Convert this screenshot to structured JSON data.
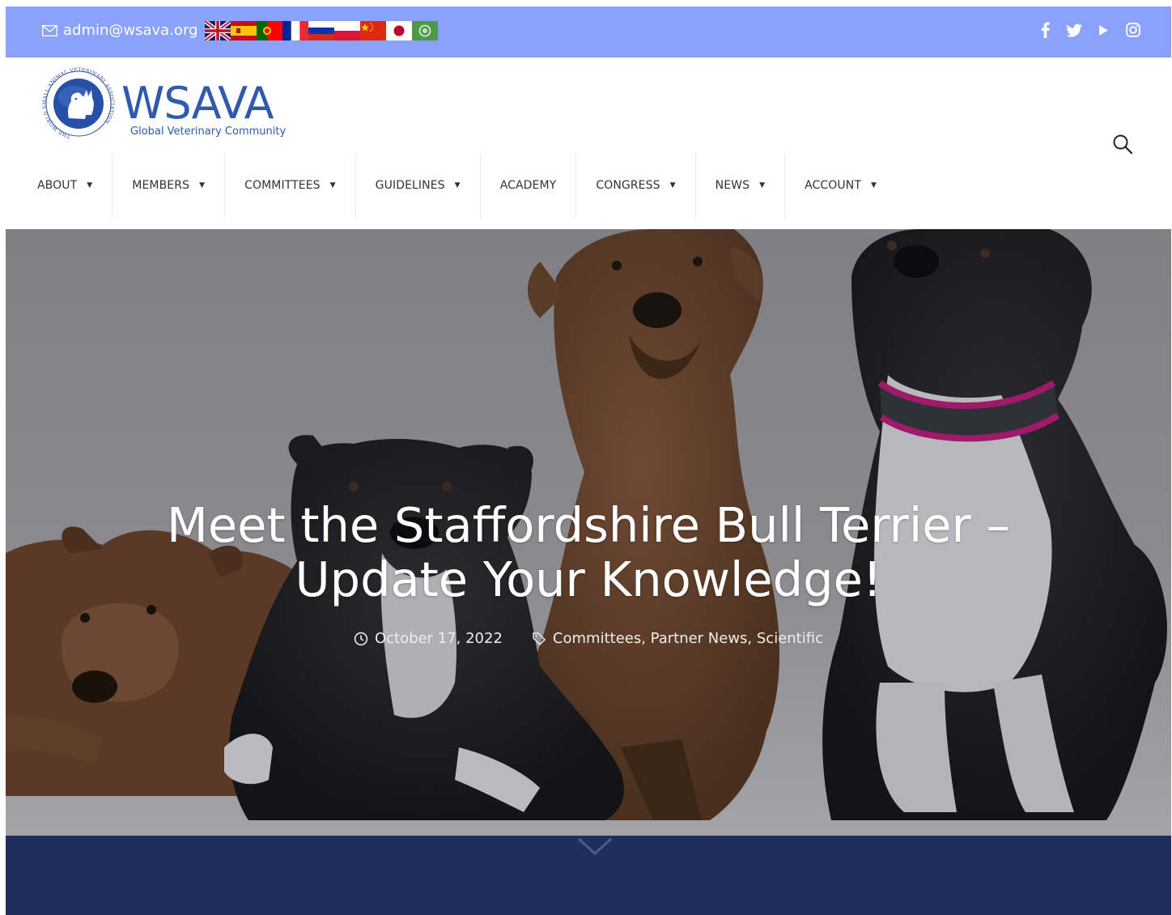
{
  "topbar": {
    "email": "admin@wsava.org",
    "flags": [
      "English",
      "Español",
      "Português",
      "Français",
      "Русский",
      "Polski",
      "中文",
      "日本語",
      "العربية"
    ],
    "socials": [
      "facebook-icon",
      "twitter-icon",
      "youtube-icon",
      "instagram-icon"
    ],
    "bg_color": "#8ba2fb"
  },
  "logo": {
    "wordmark": "WSAVA",
    "tagline": "Global Veterinary Community",
    "ring_text": "THE WORLD SMALL ANIMAL VETERINARY ASSOCIATION",
    "color": "#2a4fa6"
  },
  "nav": {
    "items": [
      {
        "label": "ABOUT",
        "dropdown": true
      },
      {
        "label": "MEMBERS",
        "dropdown": true
      },
      {
        "label": "COMMITTEES",
        "dropdown": true
      },
      {
        "label": "GUIDELINES",
        "dropdown": true
      },
      {
        "label": "ACADEMY",
        "dropdown": false
      },
      {
        "label": "CONGRESS",
        "dropdown": true
      },
      {
        "label": "NEWS",
        "dropdown": true
      },
      {
        "label": "ACCOUNT",
        "dropdown": true
      }
    ],
    "caret": "▼",
    "search_icon": "search-icon"
  },
  "hero": {
    "title_line1": "Meet the Staffordshire Bull Terrier –",
    "title_line2": "Update Your Knowledge!",
    "date": "October 17, 2022",
    "categories": "Committees, Partner News, Scientific",
    "scroll_icon": "chevron-down-icon"
  },
  "footer_band": {
    "color": "#1f2e5c"
  }
}
